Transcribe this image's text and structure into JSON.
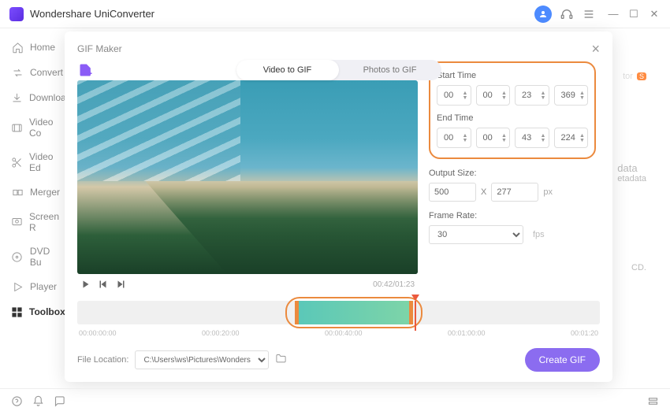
{
  "app": {
    "title": "Wondershare UniConverter"
  },
  "sidebar": {
    "items": [
      {
        "label": "Home"
      },
      {
        "label": "Convert"
      },
      {
        "label": "Downloa"
      },
      {
        "label": "Video Co"
      },
      {
        "label": "Video Ed"
      },
      {
        "label": "Merger"
      },
      {
        "label": "Screen R"
      },
      {
        "label": "DVD Bu"
      },
      {
        "label": "Player"
      },
      {
        "label": "Toolbox"
      }
    ]
  },
  "bg": {
    "tor": "tor",
    "s_badge": "S",
    "data": "data",
    "etadata": "etadata",
    "cd": "CD."
  },
  "modal": {
    "title": "GIF Maker",
    "tabs": {
      "video": "Video to GIF",
      "photos": "Photos to GIF"
    },
    "player_time": "00:42/01:23",
    "params": {
      "start_label": "Start Time",
      "end_label": "End Time",
      "start": {
        "hh": "00",
        "mm": "00",
        "ss": "23",
        "ms": "369"
      },
      "end": {
        "hh": "00",
        "mm": "00",
        "ss": "43",
        "ms": "224"
      },
      "output_label": "Output Size:",
      "width": "500",
      "x": "X",
      "height": "277",
      "px": "px",
      "frame_label": "Frame Rate:",
      "frame_rate": "30",
      "fps": "fps"
    },
    "timeline": {
      "labels": [
        "00:00:00:00",
        "00:00:20:00",
        "00:00:40:00",
        "00:01:00:00",
        "00:01:20"
      ]
    },
    "footer": {
      "loc_label": "File Location:",
      "path": "C:\\Users\\ws\\Pictures\\Wonders",
      "create": "Create GIF"
    }
  }
}
